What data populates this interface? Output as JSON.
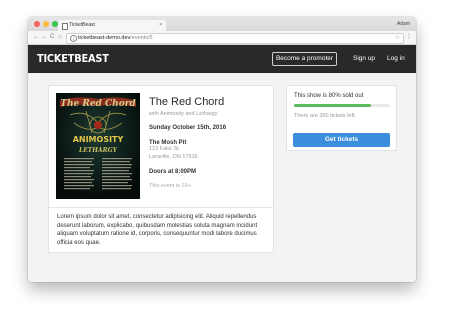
{
  "browser": {
    "tab_title": "TicketBeast",
    "tab_close": "×",
    "user": "Adam",
    "url_domain": "ticketbeast-demo.dev",
    "url_path": "/events/5",
    "back": "←",
    "forward": "→",
    "reload": "C",
    "home": "⌂",
    "star": "☆",
    "menu": "⋮",
    "info": "i"
  },
  "navbar": {
    "brand": "TICKETBEAST",
    "promoter_button": "Become a promoter",
    "signup": "Sign up",
    "login": "Log in"
  },
  "event": {
    "title": "The Red Chord",
    "subtitle": "with Animosity and Lethargy",
    "date": "Sunday October 15th, 2016",
    "venue": "The Mosh Pit",
    "address_line1": "123 Fake St.",
    "address_line2": "Laraville, ON 17916",
    "doors": "Doors at 8:00PM",
    "age_restriction": "This event is 19+.",
    "description": "Lorem ipsum dolor sit amet, consectetur adipisicing elit. Aliquid repellendus deserunt laborum, explicabo, quibusdam molestias soluta magnam incidunt aliquam voluptatum ratione id, corporis, consequuntur modi labore ducimus officia eos quae.",
    "poster": {
      "alt_band_name": "The Red Chord",
      "band2": "ANIMOSITY",
      "band3": "LETHARGY"
    }
  },
  "sidebar": {
    "sold_out_text": "This show is 80% sold out",
    "sold_out_fraction": 0.8,
    "remaining_text": "There are 350 tickets left.",
    "get_tickets_button": "Get tickets"
  },
  "colors": {
    "navbar_bg": "#292929",
    "progress": "#5cb85c",
    "button": "#3b8edb"
  }
}
